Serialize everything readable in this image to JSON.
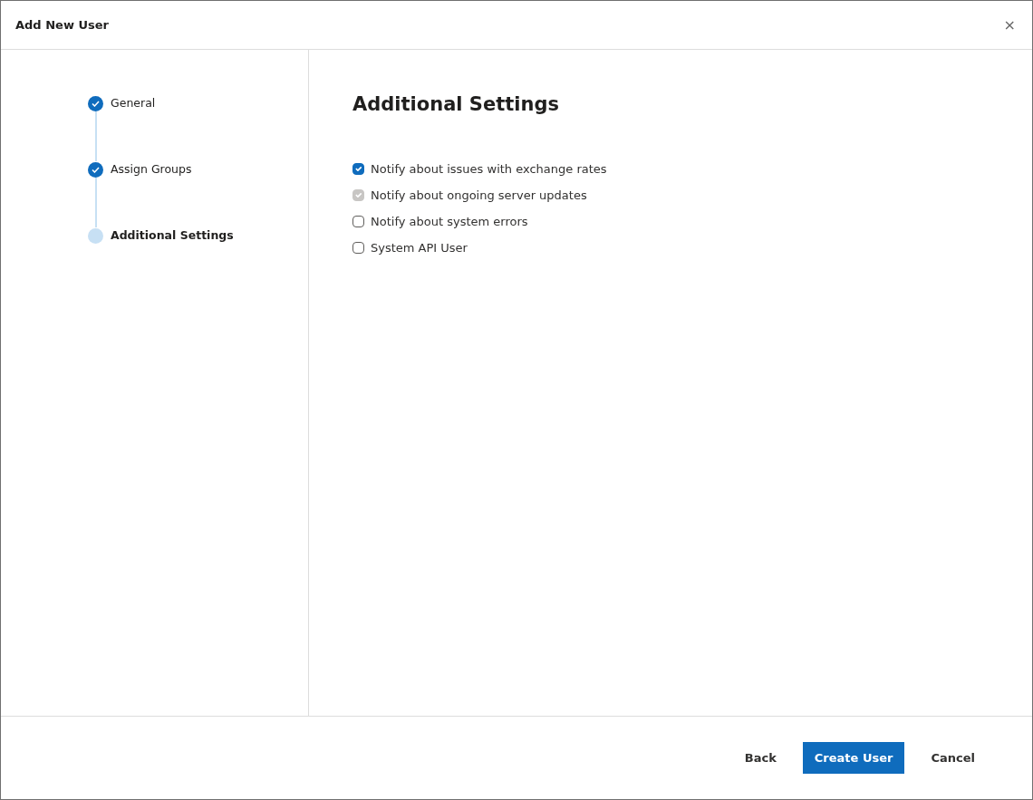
{
  "dialog": {
    "title": "Add New User",
    "close": "×"
  },
  "steps": [
    {
      "label": "General",
      "completed": true
    },
    {
      "label": "Assign Groups",
      "completed": true
    },
    {
      "label": "Additional Settings",
      "completed": false
    }
  ],
  "section_title": "Additional Settings",
  "options": [
    {
      "label": "Notify about issues with exchange rates",
      "checked": true,
      "disabled": false
    },
    {
      "label": "Notify about ongoing server updates",
      "checked": true,
      "disabled": true
    },
    {
      "label": "Notify about system errors",
      "checked": false,
      "disabled": false
    },
    {
      "label": "System API User",
      "checked": false,
      "disabled": false
    }
  ],
  "buttons": [
    {
      "label": "Back",
      "kind": "link"
    },
    {
      "label": "Create User",
      "kind": "primary"
    },
    {
      "label": "Cancel",
      "kind": "link"
    }
  ]
}
